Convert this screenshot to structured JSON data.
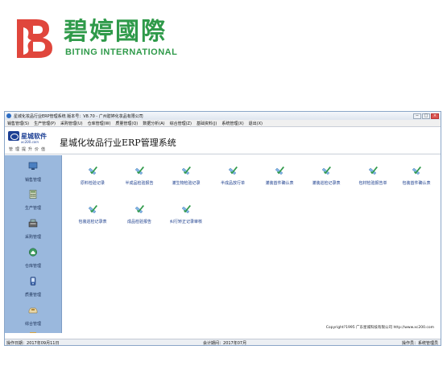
{
  "brand": {
    "name_cn": "碧婷國際",
    "name_en": "BITING INTERNATIONAL",
    "color": "#2f9a4a",
    "logo_color": "#e0463c"
  },
  "window": {
    "title": "星城化妆品行业ERP管理系统 版本号：V8.70 - 广州碧婷化妆品有限公司",
    "buttons": [
      "−",
      "□",
      "×"
    ]
  },
  "menu": [
    "销售管理(S)",
    "生产管理(P)",
    "采购管理(U)",
    "仓库管理(W)",
    "质量管理(Q)",
    "数据分析(A)",
    "综合管理(Z)",
    "基础资料(J)",
    "系统管理(X)",
    "退出(X)"
  ],
  "banner": {
    "logo_name": "星城软件",
    "logo_url": "xc200.com",
    "slogan": "管理提升价值",
    "title": "星城化妆品行业ERP管理系统"
  },
  "sidebar": {
    "items": [
      {
        "label": "销售管理",
        "icon": "monitor-icon",
        "color": "#4a7fc1"
      },
      {
        "label": "生产管理",
        "icon": "calculator-icon",
        "color": "#6b8e5a"
      },
      {
        "label": "采购管理",
        "icon": "cashier-icon",
        "color": "#555555"
      },
      {
        "label": "仓库管理",
        "icon": "warehouse-icon",
        "color": "#3c9a5f"
      },
      {
        "label": "质量管理",
        "icon": "phone-icon",
        "color": "#3a63a8"
      },
      {
        "label": "综合管理",
        "icon": "tray-icon",
        "color": "#b08a3c"
      }
    ]
  },
  "documents": [
    {
      "label": "原料检验记录"
    },
    {
      "label": "半成品检验报告"
    },
    {
      "label": "灌生物检验记录"
    },
    {
      "label": "半成品放行单"
    },
    {
      "label": "灌装首件确认表"
    },
    {
      "label": "灌装巡检记录表"
    },
    {
      "label": "包材检验报告单"
    },
    {
      "label": "包装首件确认表"
    },
    {
      "label": "包装巡检记录表"
    },
    {
      "label": "成品检验报告"
    },
    {
      "label": "纠行矫正记录审核"
    }
  ],
  "copyright": "Copyright?1995 广东星城科技有限公司 http://www.xc200.com",
  "status": {
    "date_label": "操作日期：",
    "date_value": "2017年09月11日",
    "period_label": "会计期间：",
    "period_value": "2017年07月",
    "operator_label": "操作员：",
    "operator_value": "系统管理员"
  }
}
